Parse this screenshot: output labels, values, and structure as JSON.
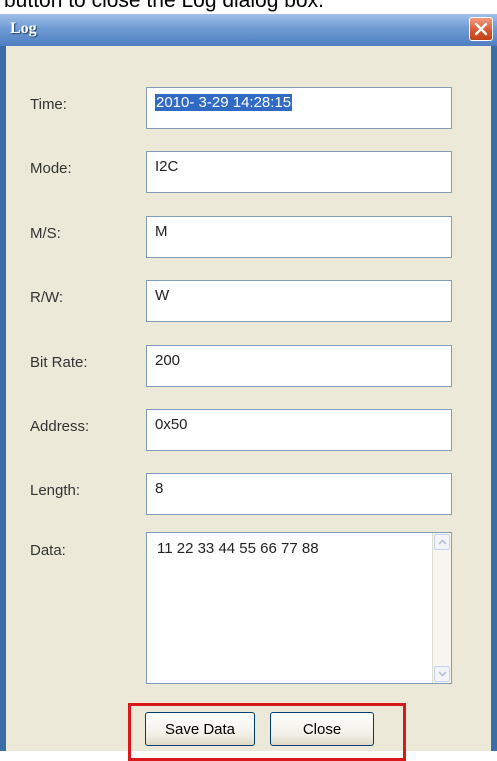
{
  "caption": "button to close the Log dialog box.",
  "window": {
    "title": "Log",
    "close_icon": "close-x-icon"
  },
  "fields": [
    {
      "label": "Time:",
      "value": "2010- 3-29 14:28:15",
      "selected": true
    },
    {
      "label": "Mode:",
      "value": "I2C"
    },
    {
      "label": "M/S:",
      "value": "M"
    },
    {
      "label": "R/W:",
      "value": "W"
    },
    {
      "label": "Bit Rate:",
      "value": "200"
    },
    {
      "label": "Address:",
      "value": "0x50"
    },
    {
      "label": "Length:",
      "value": "8"
    }
  ],
  "data_field": {
    "label": "Data:",
    "value": "11 22 33 44 55 66 77 88"
  },
  "buttons": {
    "save_label": "Save Data",
    "close_label": "Close"
  },
  "colors": {
    "highlight": "#d7191c",
    "selection": "#316ac5"
  }
}
